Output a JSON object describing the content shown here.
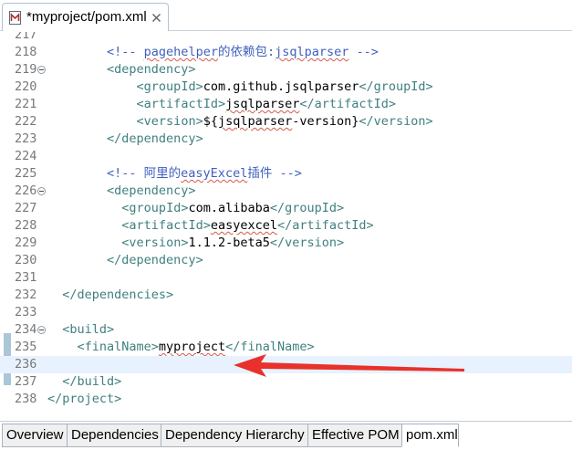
{
  "editor_tab": {
    "title": "*myproject/pom.xml"
  },
  "lines": [
    {
      "n": "217",
      "segs": []
    },
    {
      "n": "218",
      "indent": 8,
      "segs": [
        {
          "t": "<!-- ",
          "c": "c"
        },
        {
          "t": "pagehelper",
          "c": "c",
          "sq": true
        },
        {
          "t": "的依赖包:",
          "c": "c"
        },
        {
          "t": "jsqlparser",
          "c": "c",
          "sq": true
        },
        {
          "t": " -->",
          "c": "c"
        }
      ]
    },
    {
      "n": "219",
      "indent": 8,
      "fold": true,
      "segs": [
        {
          "t": "<dependency>",
          "c": "t"
        }
      ]
    },
    {
      "n": "220",
      "indent": 12,
      "segs": [
        {
          "t": "<groupId>",
          "c": "t"
        },
        {
          "t": "com.github.jsqlparser"
        },
        {
          "t": "</groupId>",
          "c": "t"
        }
      ]
    },
    {
      "n": "221",
      "indent": 12,
      "segs": [
        {
          "t": "<artifactId>",
          "c": "t"
        },
        {
          "t": "jsqlparser",
          "sq": true
        },
        {
          "t": "</artifactId>",
          "c": "t"
        }
      ]
    },
    {
      "n": "222",
      "indent": 12,
      "segs": [
        {
          "t": "<version>",
          "c": "t"
        },
        {
          "t": "${"
        },
        {
          "t": "jsqlparser",
          "sq": true
        },
        {
          "t": "-version}"
        },
        {
          "t": "</version>",
          "c": "t"
        }
      ]
    },
    {
      "n": "223",
      "indent": 8,
      "segs": [
        {
          "t": "</dependency>",
          "c": "t"
        }
      ]
    },
    {
      "n": "224",
      "segs": []
    },
    {
      "n": "225",
      "indent": 8,
      "segs": [
        {
          "t": "<!-- 阿里的",
          "c": "c"
        },
        {
          "t": "easyExcel",
          "c": "c",
          "sq": true
        },
        {
          "t": "插件 -->",
          "c": "c"
        }
      ]
    },
    {
      "n": "226",
      "indent": 8,
      "fold": true,
      "segs": [
        {
          "t": "<dependency>",
          "c": "t"
        }
      ]
    },
    {
      "n": "227",
      "indent": 10,
      "segs": [
        {
          "t": "<groupId>",
          "c": "t"
        },
        {
          "t": "com.alibaba"
        },
        {
          "t": "</groupId>",
          "c": "t"
        }
      ]
    },
    {
      "n": "228",
      "indent": 10,
      "segs": [
        {
          "t": "<artifactId>",
          "c": "t"
        },
        {
          "t": "easyexcel",
          "sq": true
        },
        {
          "t": "</artifactId>",
          "c": "t"
        }
      ]
    },
    {
      "n": "229",
      "indent": 10,
      "segs": [
        {
          "t": "<version>",
          "c": "t"
        },
        {
          "t": "1.1.2-beta5"
        },
        {
          "t": "</version>",
          "c": "t"
        }
      ]
    },
    {
      "n": "230",
      "indent": 8,
      "segs": [
        {
          "t": "</dependency>",
          "c": "t"
        }
      ]
    },
    {
      "n": "231",
      "segs": []
    },
    {
      "n": "232",
      "indent": 2,
      "segs": [
        {
          "t": "</dependencies>",
          "c": "t"
        }
      ]
    },
    {
      "n": "233",
      "segs": []
    },
    {
      "n": "234",
      "indent": 2,
      "fold": true,
      "segs": [
        {
          "t": "<build>",
          "c": "t"
        }
      ]
    },
    {
      "n": "235",
      "indent": 4,
      "segs": [
        {
          "t": "<finalName>",
          "c": "t"
        },
        {
          "t": "myproject",
          "sq": true
        },
        {
          "t": "</finalName>",
          "c": "t"
        }
      ]
    },
    {
      "n": "236",
      "current": true,
      "segs": []
    },
    {
      "n": "237",
      "indent": 2,
      "segs": [
        {
          "t": "</build>",
          "c": "t"
        }
      ]
    },
    {
      "n": "238",
      "indent": 0,
      "segs": [
        {
          "t": "</project>",
          "c": "t"
        }
      ]
    }
  ],
  "bottom_tabs": [
    {
      "label": "Overview"
    },
    {
      "label": "Dependencies"
    },
    {
      "label": "Dependency Hierarchy"
    },
    {
      "label": "Effective POM"
    },
    {
      "label": "pom.xml",
      "active": true
    }
  ],
  "colors": {
    "tag": "#3f7f7f",
    "comment": "#3f5fbf",
    "current_line": "#e8f2fe",
    "arrow": "#e8312a"
  }
}
